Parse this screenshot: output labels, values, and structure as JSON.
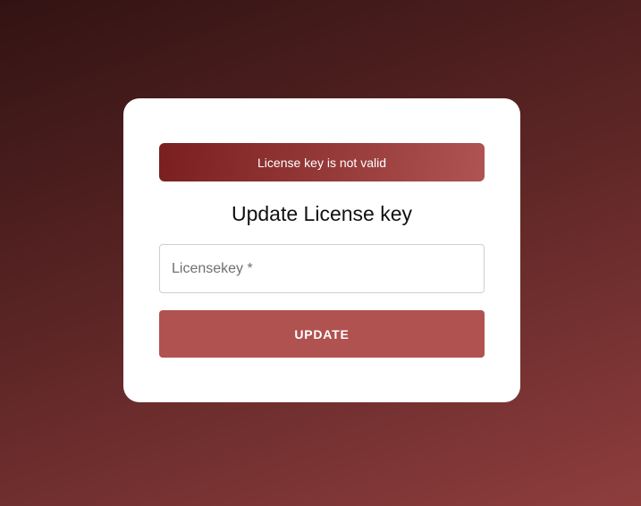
{
  "alert": {
    "message": "License key is not valid"
  },
  "form": {
    "title": "Update License key",
    "licensekey_placeholder": "Licensekey *",
    "licensekey_value": "",
    "submit_label": "UPDATE"
  },
  "colors": {
    "alert": "#8a2c2c",
    "button": "#b0524f",
    "background_start": "#321313",
    "background_end": "#8e3d3d"
  }
}
